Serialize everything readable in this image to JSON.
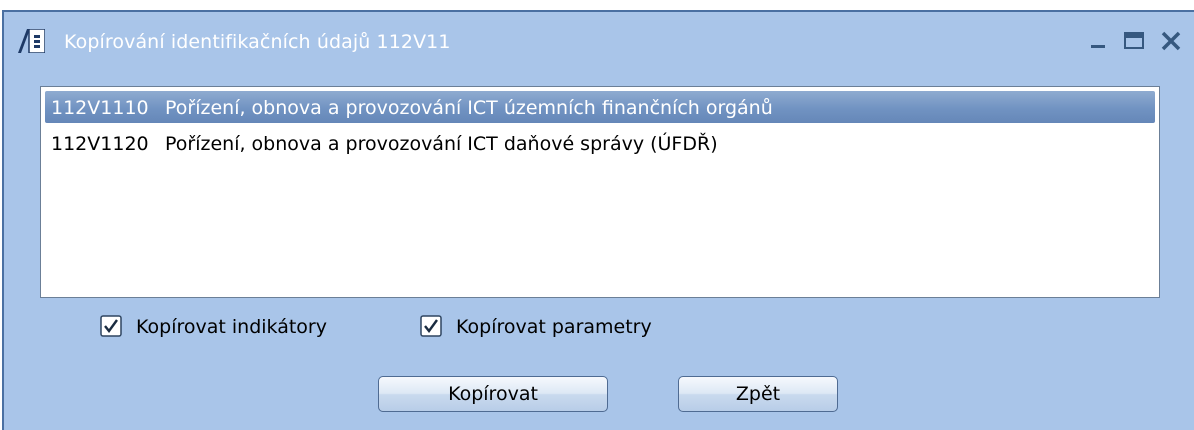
{
  "window": {
    "title": "Kopírování identifikačních údajů 112V11",
    "icon": "app-window-icon",
    "controls": [
      "minimize-icon",
      "maximize-icon",
      "close-icon"
    ]
  },
  "list": {
    "items": [
      {
        "code": "112V1110",
        "name": "Pořízení, obnova a provozování ICT územních finančních orgánů",
        "selected": true
      },
      {
        "code": "112V1120",
        "name": "Pořízení, obnova a provozování ICT daňové správy (ÚFDŘ)",
        "selected": false
      }
    ]
  },
  "options": {
    "copy_indicators": {
      "label": "Kopírovat indikátory",
      "checked": true
    },
    "copy_parameters": {
      "label": "Kopírovat parametry",
      "checked": true
    }
  },
  "buttons": {
    "copy_label": "Kopírovat",
    "back_label": "Zpět"
  },
  "colors": {
    "window_background": "#a9c5e9",
    "selection": "#7193c2",
    "title_text": "#ffffff"
  }
}
